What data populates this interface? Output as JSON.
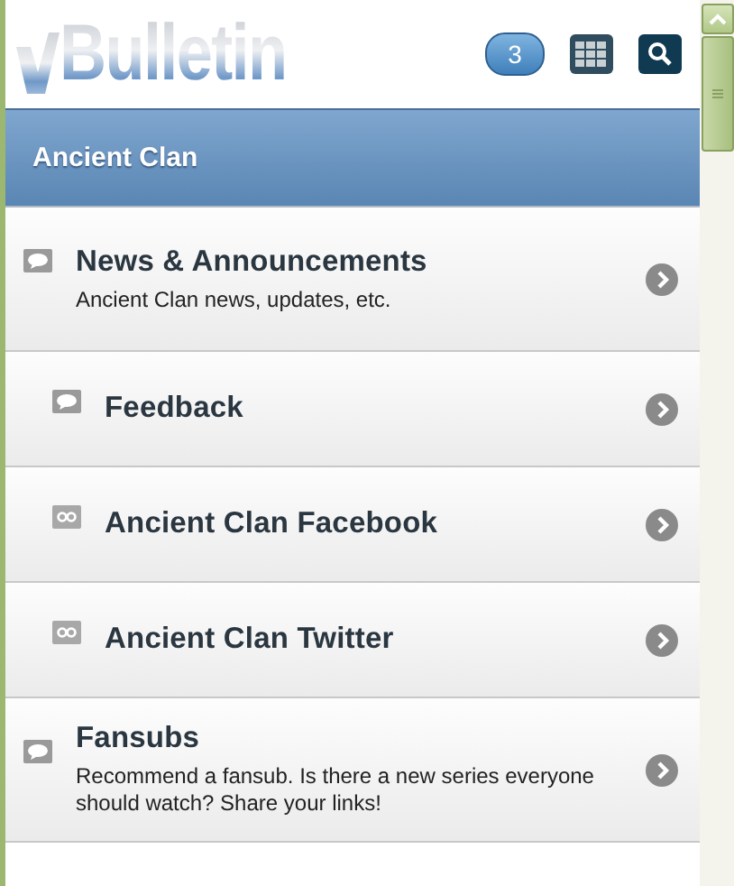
{
  "header": {
    "logo": "Bulletin",
    "notification_count": "3"
  },
  "section": {
    "title": "Ancient Clan"
  },
  "forums": [
    {
      "kind": "forum",
      "title": "News & Announcements",
      "description": "Ancient Clan news, updates, etc.",
      "children": [
        {
          "kind": "forum",
          "title": "Feedback"
        },
        {
          "kind": "link",
          "title": "Ancient Clan Facebook"
        },
        {
          "kind": "link",
          "title": "Ancient Clan Twitter"
        }
      ]
    },
    {
      "kind": "forum",
      "title": "Fansubs",
      "description": "Recommend a fansub. Is there a new series everyone should watch? Share your links!"
    }
  ]
}
